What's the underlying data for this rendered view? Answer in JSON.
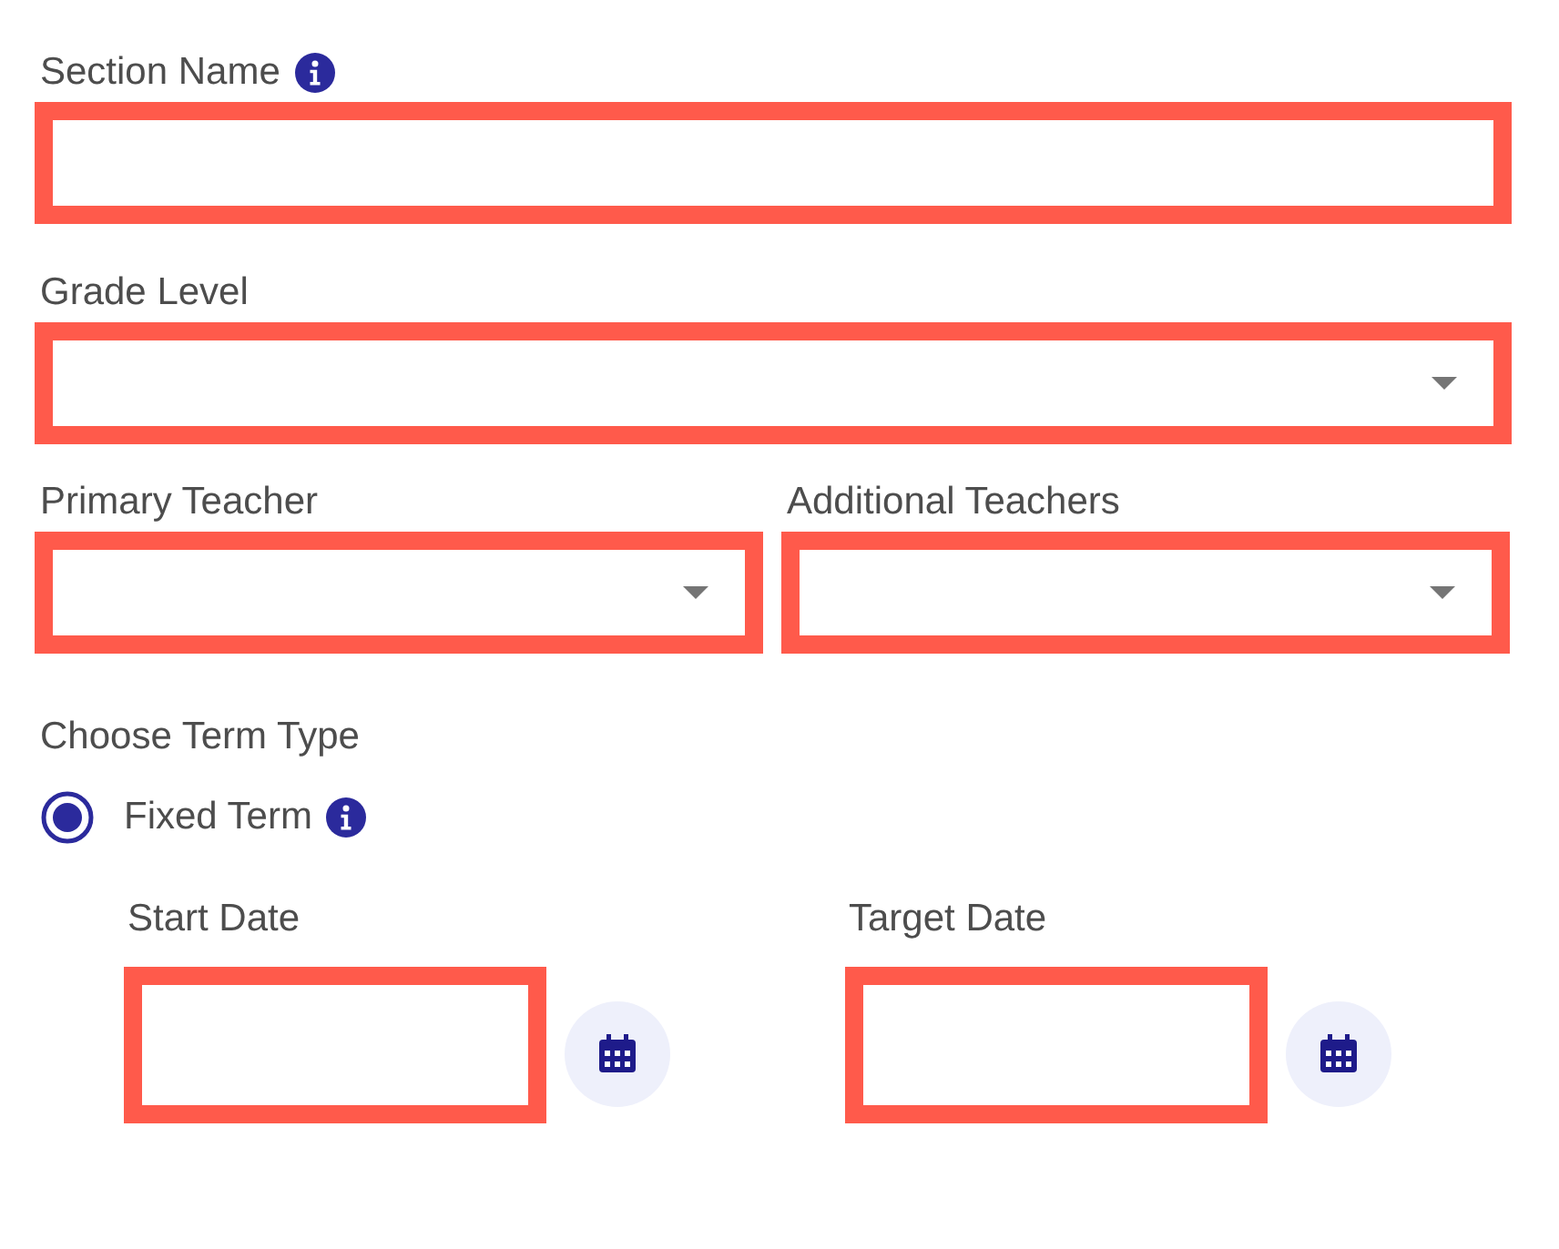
{
  "section_name": {
    "label": "Section Name",
    "info": true
  },
  "grade_level": {
    "label": "Grade Level",
    "kind": "select"
  },
  "teachers": [
    {
      "label": "Primary Teacher",
      "kind": "select"
    },
    {
      "label": "Additional Teachers",
      "kind": "select"
    }
  ],
  "term_type": {
    "label": "Choose Term Type",
    "options": [
      {
        "label": "Fixed Term",
        "selected": true,
        "info": true
      }
    ]
  },
  "dates": [
    {
      "label": "Start Date"
    },
    {
      "label": "Target Date"
    }
  ]
}
